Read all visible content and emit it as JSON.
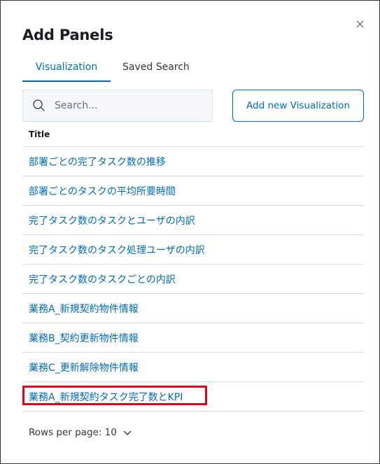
{
  "panel": {
    "title": "Add Panels",
    "close_icon": "close-icon"
  },
  "tabs": [
    {
      "label": "Visualization",
      "active": true
    },
    {
      "label": "Saved Search",
      "active": false
    }
  ],
  "search": {
    "placeholder": "Search...",
    "value": "",
    "icon": "search-icon"
  },
  "add_button": {
    "label": "Add new Visualization"
  },
  "table": {
    "column_title": "Title",
    "rows": [
      {
        "title": "部署ごとの完了タスク数の推移"
      },
      {
        "title": "部署ごとのタスクの平均所要時間"
      },
      {
        "title": "完了タスク数のタスクとユーザの内訳"
      },
      {
        "title": "完了タスク数のタスク処理ユーザの内訳"
      },
      {
        "title": "完了タスク数のタスクごとの内訳"
      },
      {
        "title": "業務A_新規契約物件情報"
      },
      {
        "title": "業務B_契約更新物件情報"
      },
      {
        "title": "業務C_更新解除物件情報"
      },
      {
        "title": "業務A_新規契約タスク完了数とKPI",
        "highlighted": true
      }
    ]
  },
  "pagination": {
    "label": "Rows per page: 10",
    "icon": "chevron-down-icon"
  },
  "colors": {
    "accent": "#006bb8",
    "highlight": "#e0001b",
    "border": "#d3dae6",
    "text": "#343741"
  }
}
